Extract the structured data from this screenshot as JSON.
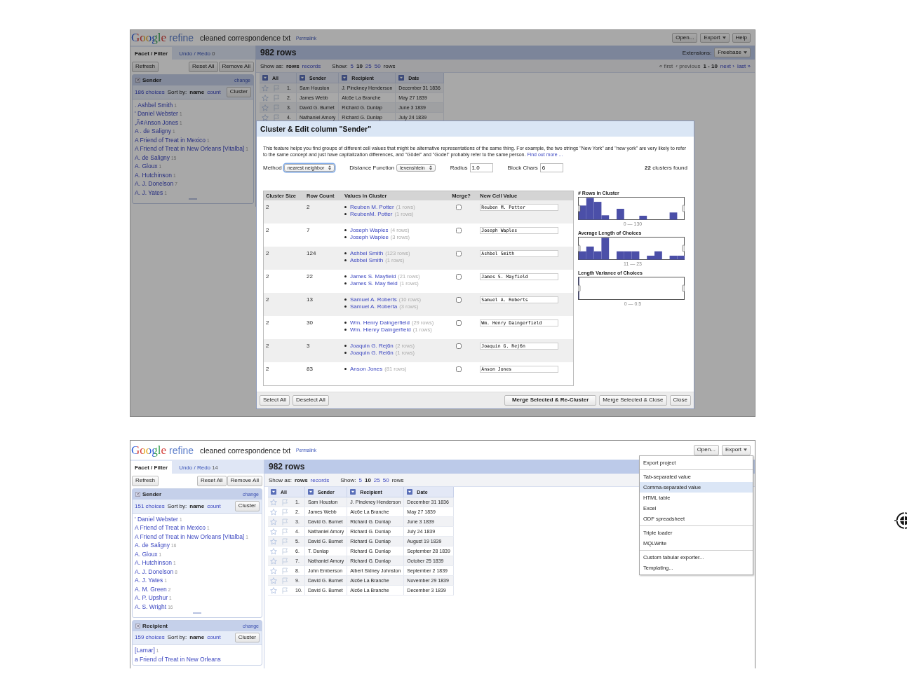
{
  "screens": [
    {
      "header": {
        "logo": [
          "Google",
          "refine"
        ],
        "project": "cleaned correspondence txt",
        "permalink": "Permalink",
        "buttons": [
          {
            "label": "Open...",
            "menu": false
          },
          {
            "label": "Export",
            "menu": true
          },
          {
            "label": "Help",
            "menu": false
          }
        ]
      },
      "tabs": [
        {
          "label": "Facet / Filter",
          "selected": true
        },
        {
          "label": "Undo / Redo",
          "count": "0",
          "selected": false
        }
      ],
      "left_buttons": [
        "Refresh",
        "Reset All",
        "Remove All"
      ],
      "facets": [
        {
          "title": "Sender",
          "change": "change",
          "choices": "186 choices",
          "sort_label": "Sort by:",
          "sort_options": [
            {
              "label": "name",
              "selected": true
            },
            {
              "label": "count",
              "selected": false
            }
          ],
          "cluster": "Cluster",
          "resize_handle": true,
          "items": [
            {
              "name": ". Ashbel Smith",
              "count": "1"
            },
            {
              "name": "' Daniel Webster",
              "count": "1"
            },
            {
              "name": ",Ä¢Anson Jones",
              "count": "1"
            },
            {
              "name": "A . de Saligny",
              "count": "1"
            },
            {
              "name": "A Friend of Treat in Mexico",
              "count": "1"
            },
            {
              "name": "A Friend of Treat in New Orleans [Vitalba]",
              "count": "1"
            },
            {
              "name": "A. de Saligny",
              "count": "15"
            },
            {
              "name": "A. Gloux",
              "count": "1"
            },
            {
              "name": "A. Hutchinson",
              "count": "1"
            },
            {
              "name": "A. J. Donelson",
              "count": "7"
            },
            {
              "name": "A. J. Yates",
              "count": "1"
            }
          ]
        }
      ],
      "rows_title": "982 rows",
      "extensions": {
        "label": "Extensions:",
        "button": "Freebase"
      },
      "show_as": {
        "label": "Show as:",
        "options": [
          {
            "label": "rows",
            "selected": true
          },
          {
            "label": "records",
            "selected": false
          }
        ]
      },
      "show": {
        "label": "Show:",
        "options": [
          {
            "label": "5",
            "selected": false
          },
          {
            "label": "10",
            "selected": true
          },
          {
            "label": "25",
            "selected": false
          },
          {
            "label": "50",
            "selected": false
          }
        ],
        "suffix": "rows"
      },
      "pager": {
        "before": [
          {
            "label": "« first",
            "disabled": true
          },
          {
            "label": "‹ previous",
            "disabled": true
          }
        ],
        "range": "1 - 10",
        "after": [
          {
            "label": "next ›",
            "disabled": false
          },
          {
            "label": "last »",
            "disabled": false
          }
        ]
      },
      "columns": [
        "All",
        "Sender",
        "Recipient",
        "Date"
      ],
      "rows": [
        {
          "cells": [
            "1.",
            "Sam Houston",
            "J. Pinckney Henderson",
            "December 31 1836"
          ]
        },
        {
          "cells": [
            "2.",
            "James Webb",
            "Alc6e La Branche",
            "May 27 1839"
          ]
        },
        {
          "cells": [
            "3.",
            "David G. Burnet",
            "Richard G. Dunlap",
            "June 3 1839"
          ]
        },
        {
          "cells": [
            "4.",
            "Nathaniel Amory",
            "Richard G. Dunlap",
            "July 24 1839"
          ]
        }
      ],
      "dialog": {
        "title": "Cluster & Edit column \"Sender\"",
        "description": "This feature helps you find groups of different cell values that might be alternative representations of the same thing. For example, the two strings \"New York\" and \"new york\" are very likely to refer to the same concept and just have capitalization differences, and \"Gödel\" and \"Godel\" probably refer to the same person.",
        "link": "Find out more ...",
        "method": {
          "label": "Method",
          "value": "nearest neighbor"
        },
        "distance": {
          "label": "Distance Function",
          "value": "levenshtein"
        },
        "radius": {
          "label": "Radius",
          "value": "1.0"
        },
        "block_chars": {
          "label": "Block Chars",
          "value": "6"
        },
        "found": "**22** clusters found",
        "columns": [
          "Cluster Size",
          "Row Count",
          "Values in Cluster",
          "Merge?",
          "New Cell Value"
        ],
        "clusters": [
          {
            "size": "2",
            "row_count": "2",
            "values": [
              {
                "name": "Reuben M. Potter",
                "rows": "(1 rows)"
              },
              {
                "name": "ReubenM. Potter",
                "rows": "(1 rows)"
              }
            ],
            "merge": false,
            "new_value": "Reuben M. Potter"
          },
          {
            "size": "2",
            "row_count": "7",
            "values": [
              {
                "name": "Joseph Waples",
                "rows": "(4 rows)"
              },
              {
                "name": "Joseph Waplee",
                "rows": "(3 rows)"
              }
            ],
            "merge": false,
            "new_value": "Joseph Waples"
          },
          {
            "size": "2",
            "row_count": "124",
            "values": [
              {
                "name": "Ashbel Smith",
                "rows": "(123 rows)"
              },
              {
                "name": "Asbbel Smith",
                "rows": "(1 rows)"
              }
            ],
            "merge": false,
            "new_value": "Ashbel Smith"
          },
          {
            "size": "2",
            "row_count": "22",
            "values": [
              {
                "name": "James S. Mayfield",
                "rows": "(21 rows)"
              },
              {
                "name": "James S. May field",
                "rows": "(1 rows)"
              }
            ],
            "merge": false,
            "new_value": "James S. Mayfield"
          },
          {
            "size": "2",
            "row_count": "13",
            "values": [
              {
                "name": "Samuel A. Roberts",
                "rows": "(10 rows)"
              },
              {
                "name": "Samuel A. Roberta",
                "rows": "(3 rows)"
              }
            ],
            "merge": false,
            "new_value": "Samuel A. Roberts"
          },
          {
            "size": "2",
            "row_count": "30",
            "values": [
              {
                "name": "Wm. Henry Daingerfield",
                "rows": "(29 rows)"
              },
              {
                "name": "Wm. Hienry Daingerfield",
                "rows": "(1 rows)"
              }
            ],
            "merge": false,
            "new_value": "Wm. Henry Daingerfield"
          },
          {
            "size": "2",
            "row_count": "3",
            "values": [
              {
                "name": "Joaquin G. Rej6n",
                "rows": "(2 rows)"
              },
              {
                "name": "Joaquin G. Rei6n",
                "rows": "(1 rows)"
              }
            ],
            "merge": false,
            "new_value": "Joaquin G. Rej6n"
          },
          {
            "size": "2",
            "row_count": "83",
            "values": [
              {
                "name": "Anson Jones",
                "rows": "(81 rows)"
              }
            ],
            "merge": false,
            "new_value": "Anson Jones"
          }
        ],
        "histograms": [
          {
            "title": "# Rows in Cluster",
            "range": "0 — 130"
          },
          {
            "title": "Average Length of Choices",
            "range": "11 — 23"
          },
          {
            "title": "Length Variance of Choices",
            "range": "0 — 0.5"
          }
        ],
        "footer_left": [
          {
            "label": "Select All",
            "primary": false
          },
          {
            "label": "Deselect All",
            "primary": false
          }
        ],
        "footer_right": [
          {
            "label": "Merge Selected & Re-Cluster",
            "primary": true
          },
          {
            "label": "Merge Selected & Close",
            "primary": false
          },
          {
            "label": "Close",
            "primary": false
          }
        ]
      }
    },
    {
      "header": {
        "logo": [
          "Google",
          "refine"
        ],
        "project": "cleaned correspondence txt",
        "permalink": "Permalink",
        "buttons": [
          {
            "label": "Open...",
            "menu": false
          },
          {
            "label": "Export",
            "menu": true
          }
        ]
      },
      "tabs": [
        {
          "label": "Facet / Filter",
          "selected": true
        },
        {
          "label": "Undo / Redo",
          "count": "14",
          "selected": false
        }
      ],
      "left_buttons": [
        "Refresh",
        "Reset All",
        "Remove All"
      ],
      "facets": [
        {
          "title": "Sender",
          "change": "change",
          "choices": "151 choices",
          "sort_label": "Sort by:",
          "sort_options": [
            {
              "label": "name",
              "selected": true
            },
            {
              "label": "count",
              "selected": false
            }
          ],
          "cluster": "Cluster",
          "resize_handle": true,
          "items": [
            {
              "name": "' Daniel Webster",
              "count": "1"
            },
            {
              "name": "A Friend of Treat in Mexico",
              "count": "1"
            },
            {
              "name": "A Friend of Treat in New Orleans [Vitalba]",
              "count": "1"
            },
            {
              "name": "A. de Saligny",
              "count": "16"
            },
            {
              "name": "A. Gloux",
              "count": "1"
            },
            {
              "name": "A. Hutchinson",
              "count": "1"
            },
            {
              "name": "A. J. Donelson",
              "count": "8"
            },
            {
              "name": "A. J. Yates",
              "count": "1"
            },
            {
              "name": "A. M. Green",
              "count": "2"
            },
            {
              "name": "A. P. Upshur",
              "count": "1"
            },
            {
              "name": "A. S. Wright",
              "count": "16"
            }
          ]
        },
        {
          "title": "Recipient",
          "change": "change",
          "choices": "159 choices",
          "sort_label": "Sort by:",
          "sort_options": [
            {
              "label": "name",
              "selected": true
            },
            {
              "label": "count",
              "selected": false
            }
          ],
          "cluster": "Cluster",
          "resize_handle": false,
          "items": [
            {
              "name": "[Lamar]",
              "count": "1"
            },
            {
              "name": "a Friend of Treat in New Orleans"
            }
          ]
        }
      ],
      "rows_title": "982 rows",
      "show_as": {
        "label": "Show as:",
        "options": [
          {
            "label": "rows",
            "selected": true
          },
          {
            "label": "records",
            "selected": false
          }
        ]
      },
      "show": {
        "label": "Show:",
        "options": [
          {
            "label": "5",
            "selected": false
          },
          {
            "label": "10",
            "selected": true
          },
          {
            "label": "25",
            "selected": false
          },
          {
            "label": "50",
            "selected": false
          }
        ],
        "suffix": "rows"
      },
      "columns": [
        "All",
        "Sender",
        "Recipient",
        "Date"
      ],
      "rows": [
        {
          "cells": [
            "1.",
            "Sam Houston",
            "J. Pinckney Henderson",
            "December 31 1836"
          ]
        },
        {
          "cells": [
            "2.",
            "James Webb",
            "Alc6e La Branche",
            "May 27 1839"
          ]
        },
        {
          "cells": [
            "3.",
            "David G. Burnet",
            "Richard G. Dunlap",
            "June 3 1839"
          ]
        },
        {
          "cells": [
            "4.",
            "Nathaniel Amory",
            "Richard G. Dunlap",
            "July 24 1839"
          ]
        },
        {
          "cells": [
            "5.",
            "David G. Burnet",
            "Richard G. Dunlap",
            "August 19 1839"
          ]
        },
        {
          "cells": [
            "6.",
            "T. Dunlap",
            "Richard G. Dunlap",
            "September 28 1839"
          ]
        },
        {
          "cells": [
            "7.",
            "Nathaniel Amory",
            "Richard G. Dunlap",
            "October 25 1839"
          ]
        },
        {
          "cells": [
            "8.",
            "John Emberson",
            "Albert Sidney Johnston",
            "September 2 1839"
          ]
        },
        {
          "cells": [
            "9.",
            "David G. Burnet",
            "Alc6e La Branche",
            "November 29 1839"
          ]
        },
        {
          "cells": [
            "10.",
            "David G. Burnet",
            "Alc6e La Branche",
            "December 3 1839"
          ]
        }
      ],
      "export_menu": {
        "groups": [
          [
            {
              "label": "Export project",
              "selected": false
            }
          ],
          [
            {
              "label": "Tab-separated value",
              "selected": false
            },
            {
              "label": "Comma-separated value",
              "selected": true
            },
            {
              "label": "HTML table",
              "selected": false
            },
            {
              "label": "Excel",
              "selected": false
            },
            {
              "label": "ODF spreadsheet",
              "selected": false
            }
          ],
          [
            {
              "label": "Triple loader",
              "selected": false
            },
            {
              "label": "MQLWrite",
              "selected": false
            }
          ],
          [
            {
              "label": "Custom tabular exporter...",
              "selected": false
            },
            {
              "label": "Templating...",
              "selected": false
            }
          ]
        ]
      }
    }
  ]
}
